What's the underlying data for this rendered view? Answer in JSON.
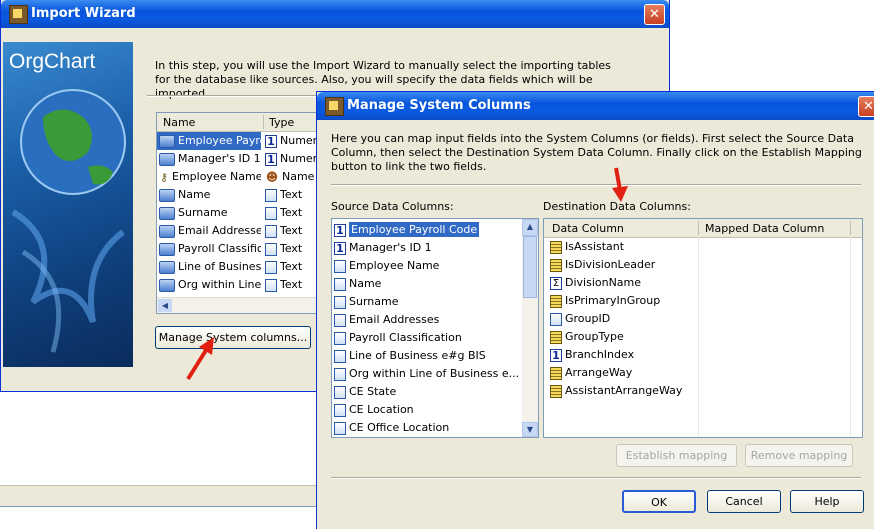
{
  "import_wizard": {
    "title": "Import Wizard",
    "logo_text": "OrgChart",
    "description": "In this step, you will use the Import Wizard to manually select the importing tables for the database like sources. Also, you will specify the data fields which will be imported.",
    "columns": {
      "name": "Name",
      "type": "Type"
    },
    "rows": [
      {
        "name": "Employee Payro",
        "type": "Numer",
        "row_icon": "arrow",
        "type_icon": "number"
      },
      {
        "name": "Manager's ID 1",
        "type": "Numer",
        "row_icon": "arrow",
        "type_icon": "number"
      },
      {
        "name": "Employee Name",
        "type": "Name",
        "row_icon": "key",
        "type_icon": "person"
      },
      {
        "name": "Name",
        "type": "Text",
        "row_icon": "arrow",
        "type_icon": "document"
      },
      {
        "name": "Surname",
        "type": "Text",
        "row_icon": "arrow",
        "type_icon": "document"
      },
      {
        "name": "Email Addresses",
        "type": "Text",
        "row_icon": "arrow",
        "type_icon": "document"
      },
      {
        "name": "Payroll Classifica",
        "type": "Text",
        "row_icon": "arrow",
        "type_icon": "document"
      },
      {
        "name": "Line of Business",
        "type": "Text",
        "row_icon": "arrow",
        "type_icon": "document"
      },
      {
        "name": "Org within Line (",
        "type": "Text",
        "row_icon": "arrow",
        "type_icon": "document"
      }
    ],
    "manage_button": "Manage System columns...",
    "num_glyph": "1",
    "close_glyph": "✕",
    "scroll_left_glyph": "◀"
  },
  "manage_dialog": {
    "title": "Manage System Columns",
    "description": "Here you can map input fields into the System Columns (or fields).  First select the Source Data Column, then select the Destination System Data Column. Finally click on the Establish Mapping button to link the two fields.",
    "source_label": "Source Data Columns:",
    "destination_label": "Destination Data Columns:",
    "source_items": [
      {
        "label": "Employee Payroll Code",
        "icon": "number",
        "selected": true
      },
      {
        "label": "Manager's ID 1",
        "icon": "number",
        "selected": false
      },
      {
        "label": "Employee Name",
        "icon": "document",
        "selected": false
      },
      {
        "label": "Name",
        "icon": "document",
        "selected": false
      },
      {
        "label": "Surname",
        "icon": "document",
        "selected": false
      },
      {
        "label": "Email Addresses",
        "icon": "document",
        "selected": false
      },
      {
        "label": "Payroll Classification",
        "icon": "document",
        "selected": false
      },
      {
        "label": "Line of Business e#g BIS",
        "icon": "document",
        "selected": false
      },
      {
        "label": "Org within Line of Business e...",
        "icon": "document",
        "selected": false
      },
      {
        "label": "CE State",
        "icon": "document",
        "selected": false
      },
      {
        "label": "CE Location",
        "icon": "document",
        "selected": false
      },
      {
        "label": "CE Office Location",
        "icon": "document",
        "selected": false
      }
    ],
    "dest_headers": {
      "data_column": "Data Column",
      "mapped": "Mapped Data Column"
    },
    "dest_items": [
      {
        "label": "IsAssistant",
        "icon": "grid"
      },
      {
        "label": "IsDivisionLeader",
        "icon": "grid"
      },
      {
        "label": "DivisionName",
        "icon": "sigma"
      },
      {
        "label": "IsPrimaryInGroup",
        "icon": "grid"
      },
      {
        "label": "GroupID",
        "icon": "document"
      },
      {
        "label": "GroupType",
        "icon": "grid"
      },
      {
        "label": "BranchIndex",
        "icon": "number"
      },
      {
        "label": "ArrangeWay",
        "icon": "grid"
      },
      {
        "label": "AssistantArrangeWay",
        "icon": "grid"
      }
    ],
    "establish_button": "Establish mapping",
    "remove_button": "Remove mapping",
    "ok_button": "OK",
    "cancel_button": "Cancel",
    "help_button": "Help",
    "sigma_glyph": "Σ",
    "close_glyph": "✕",
    "scroll_up_glyph": "▲",
    "scroll_down_glyph": "▼"
  },
  "colors": {
    "xp_blue": "#0a5ae0",
    "selection": "#316ac5",
    "dialog_bg": "#ece9d8",
    "annotation_arrow": "#e02010"
  }
}
